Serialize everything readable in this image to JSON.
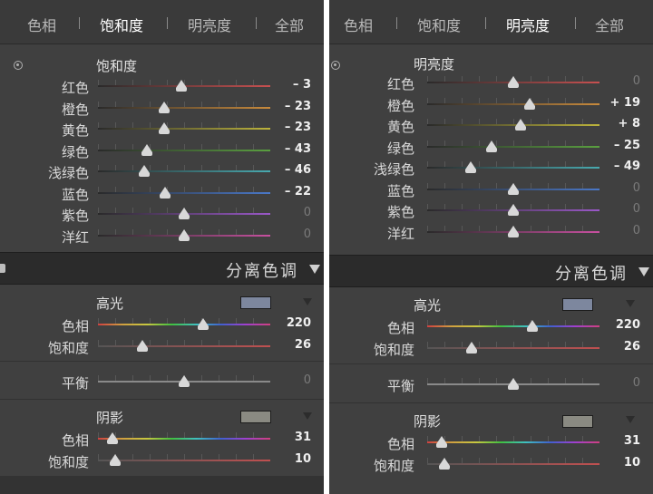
{
  "colors": {
    "red": "#c85050",
    "orange": "#c88a3c",
    "yellow": "#bdb43c",
    "green": "#5aa040",
    "aqua": "#48aab0",
    "blue": "#4a78c8",
    "purple": "#9a58c8",
    "magenta": "#c850a0",
    "highlight_swatch": "#7d879e",
    "shadow_swatch": "#8a8a82"
  },
  "left": {
    "tabs": [
      {
        "label": "色相",
        "active": false
      },
      {
        "label": "饱和度",
        "active": true
      },
      {
        "label": "明亮度",
        "active": false
      },
      {
        "label": "全部",
        "active": false
      }
    ],
    "section_title": "饱和度",
    "sliders": [
      {
        "label": "红色",
        "value": "– 3",
        "num": -3,
        "dim": false
      },
      {
        "label": "橙色",
        "value": "– 23",
        "num": -23,
        "dim": false
      },
      {
        "label": "黄色",
        "value": "– 23",
        "num": -23,
        "dim": false
      },
      {
        "label": "绿色",
        "value": "– 43",
        "num": -43,
        "dim": false
      },
      {
        "label": "浅绿色",
        "value": "– 46",
        "num": -46,
        "dim": false
      },
      {
        "label": "蓝色",
        "value": "– 22",
        "num": -22,
        "dim": false
      },
      {
        "label": "紫色",
        "value": "0",
        "num": 0,
        "dim": true
      },
      {
        "label": "洋红",
        "value": "0",
        "num": 0,
        "dim": true
      }
    ]
  },
  "right": {
    "tabs": [
      {
        "label": "色相",
        "active": false
      },
      {
        "label": "饱和度",
        "active": false
      },
      {
        "label": "明亮度",
        "active": true
      },
      {
        "label": "全部",
        "active": false
      }
    ],
    "section_title": "明亮度",
    "sliders": [
      {
        "label": "红色",
        "value": "0",
        "num": 0,
        "dim": true
      },
      {
        "label": "橙色",
        "value": "+ 19",
        "num": 19,
        "dim": false
      },
      {
        "label": "黄色",
        "value": "+ 8",
        "num": 8,
        "dim": false
      },
      {
        "label": "绿色",
        "value": "– 25",
        "num": -25,
        "dim": false
      },
      {
        "label": "浅绿色",
        "value": "– 49",
        "num": -49,
        "dim": false
      },
      {
        "label": "蓝色",
        "value": "0",
        "num": 0,
        "dim": true
      },
      {
        "label": "紫色",
        "value": "0",
        "num": 0,
        "dim": true
      },
      {
        "label": "洋红",
        "value": "0",
        "num": 0,
        "dim": true
      }
    ]
  },
  "split_toning": {
    "title": "分离色调",
    "highlights": {
      "title": "高光",
      "hue": {
        "label": "色相",
        "value": "220",
        "num": 220
      },
      "saturation": {
        "label": "饱和度",
        "value": "26",
        "num": 26
      }
    },
    "balance": {
      "label": "平衡",
      "value": "0",
      "num": 0
    },
    "shadows": {
      "title": "阴影",
      "hue": {
        "label": "色相",
        "value": "31",
        "num": 31
      },
      "saturation": {
        "label": "饱和度",
        "value": "10",
        "num": 10
      }
    }
  }
}
